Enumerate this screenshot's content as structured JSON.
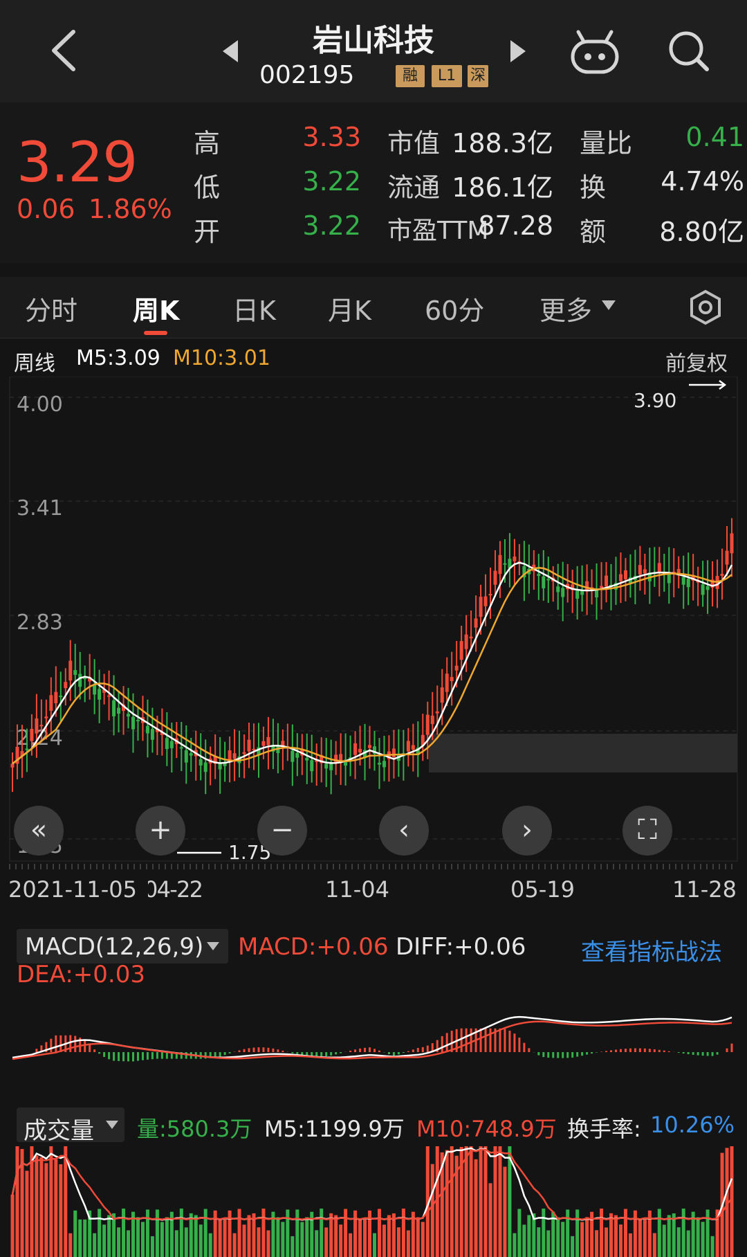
{
  "header": {
    "title": "岩山科技",
    "code": "002195",
    "tags": [
      "融",
      "L1",
      "深"
    ]
  },
  "quote": {
    "price": "3.29",
    "change": "0.06",
    "change_pct": "1.86%",
    "high_label": "高",
    "high": "3.33",
    "low_label": "低",
    "low": "3.22",
    "open_label": "开",
    "open": "3.22",
    "mktcap_label": "市值",
    "mktcap": "188.3亿",
    "float_label": "流通",
    "float": "186.1亿",
    "pe_label": "市盈TTM",
    "pe": "87.28",
    "ratio_label": "量比",
    "ratio": "0.41",
    "turnover_label": "换",
    "turnover": "4.74%",
    "amount_label": "额",
    "amount": "8.80亿"
  },
  "tabs": [
    "分时",
    "周K",
    "日K",
    "月K",
    "60分",
    "更多"
  ],
  "kline": {
    "period": "周线",
    "m5": "M5:3.09",
    "m10": "M10:3.01",
    "adjust": "前复权",
    "y_labels": [
      "4.00",
      "3.41",
      "2.83",
      "2.24",
      "1.65"
    ],
    "x_labels": [
      "2021-11-05",
      "04-22",
      "11-04",
      "05-19",
      "11-28"
    ],
    "max_label": "3.90",
    "min_label": "1.75"
  },
  "macd": {
    "selector": "MACD(12,26,9)",
    "macd": "MACD:+0.06",
    "diff": "DIFF:+0.06",
    "dea": "DEA:+0.03",
    "link": "查看指标战法"
  },
  "volume": {
    "selector": "成交量",
    "vol": "量:580.3万",
    "m5": "M5:1199.9万",
    "m10": "M10:748.9万",
    "turnover_label": "换手率:",
    "turnover": "10.26%"
  },
  "colors": {
    "up": "#f04a38",
    "down": "#35b04a",
    "m5": "#ffffff",
    "m10": "#f0a830",
    "link": "#3a8fe8"
  }
}
